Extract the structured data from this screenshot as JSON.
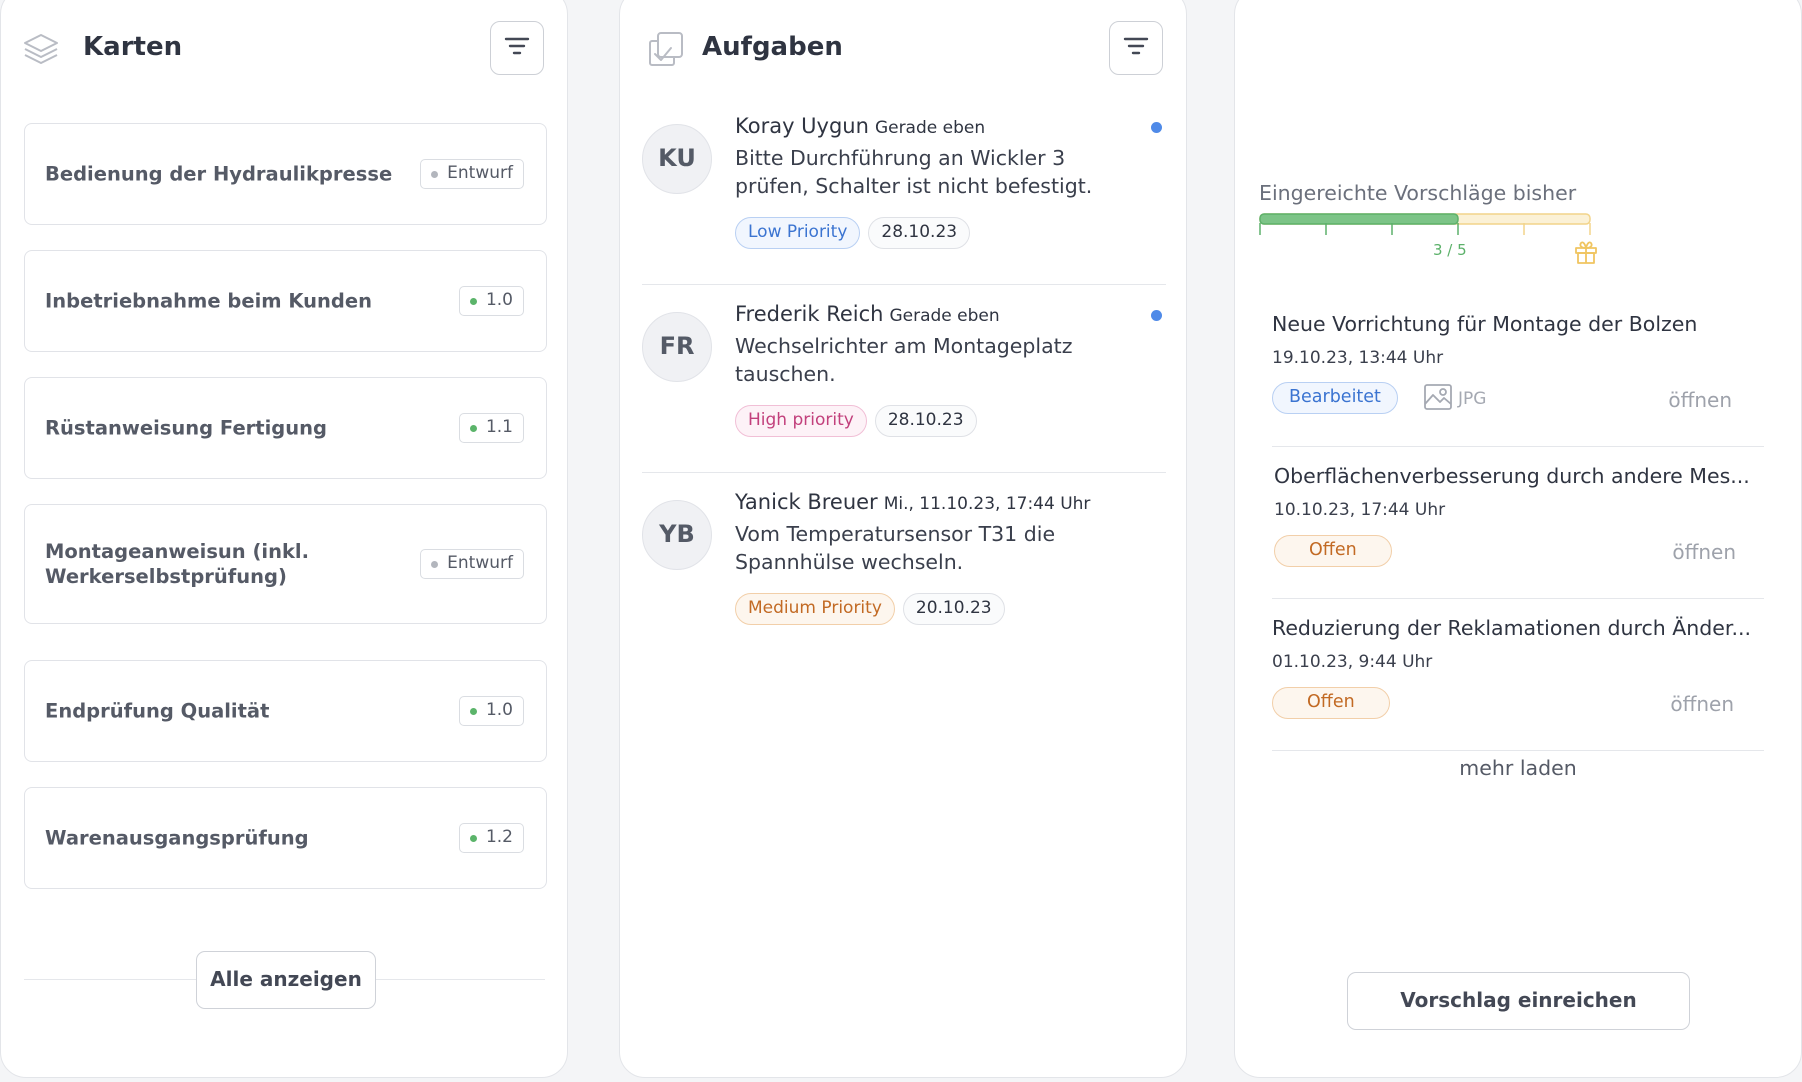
{
  "karten": {
    "title": "Karten",
    "items": [
      {
        "title": "Bedienung der Hydraulikpresse",
        "badge": "Entwurf",
        "status_color": "#b3b6bd"
      },
      {
        "title": "Inbetriebnahme beim Kunden",
        "badge": "1.0",
        "status_color": "#5bb46a"
      },
      {
        "title": "Rüstanweisung Fertigung",
        "badge": "1.1",
        "status_color": "#5bb46a"
      },
      {
        "title": "Montageanweisun (inkl. Werkerselbstprüfung)",
        "badge": "Entwurf",
        "status_color": "#b3b6bd"
      },
      {
        "title": "Endprüfung Qualität",
        "badge": "1.0",
        "status_color": "#5bb46a"
      },
      {
        "title": "Warenausgangsprüfung",
        "badge": "1.2",
        "status_color": "#5bb46a"
      }
    ],
    "show_all_label": "Alle anzeigen"
  },
  "aufgaben": {
    "title": "Aufgaben",
    "items": [
      {
        "initials": "KU",
        "name": "Koray Uygun",
        "time": "Gerade eben",
        "text": "Bitte Durchführung an Wickler 3 prüfen, Schalter ist nicht befestigt.",
        "priority": "Low Priority",
        "date": "28.10.23",
        "unread": true
      },
      {
        "initials": "FR",
        "name": "Frederik Reich",
        "time": "Gerade eben",
        "text": "Wechselrichter am Montageplatz tauschen.",
        "priority": "High priority",
        "date": "28.10.23",
        "unread": true
      },
      {
        "initials": "YB",
        "name": "Yanick Breuer",
        "time": "Mi., 11.10.23, 17:44 Uhr",
        "text": "Vom Temperatursensor T31 die Spannhülse wechseln.",
        "priority": "Medium Priority",
        "date": "20.10.23",
        "unread": false
      }
    ]
  },
  "vorschlaege": {
    "progress_label": "Eingereichte Vorschläge bisher",
    "progress_count": "3 / 5",
    "progress_value": 3,
    "progress_total": 5,
    "items": [
      {
        "title": "Neue Vorrichtung für Montage der Bolzen",
        "date": "19.10.23, 13:44 Uhr",
        "status": "Bearbeitet",
        "attachment": "JPG",
        "open_label": "öffnen"
      },
      {
        "title": "Oberflächenverbesserung durch andere Mes...",
        "date": "10.10.23, 17:44 Uhr",
        "status": "Offen",
        "attachment": "",
        "open_label": "öffnen"
      },
      {
        "title": "Reduzierung der Reklamationen durch Änder...",
        "date": "01.10.23, 9:44 Uhr",
        "status": "Offen",
        "attachment": "",
        "open_label": "öffnen"
      }
    ],
    "more_label": "mehr laden",
    "submit_label": "Vorschlag einreichen"
  },
  "colors": {
    "accent_blue": "#4f8ae8",
    "progress_green": "#5cb16a",
    "progress_yellow": "#f2d48a",
    "low_priority": "#3b74d1",
    "high_priority": "#c2407c",
    "medium_priority": "#c26a24"
  },
  "icons": {
    "karten": "layers-icon",
    "aufgaben": "checkbox-stack-icon",
    "filter": "filter-icon",
    "reward": "gift-icon",
    "attachment": "image-icon"
  }
}
